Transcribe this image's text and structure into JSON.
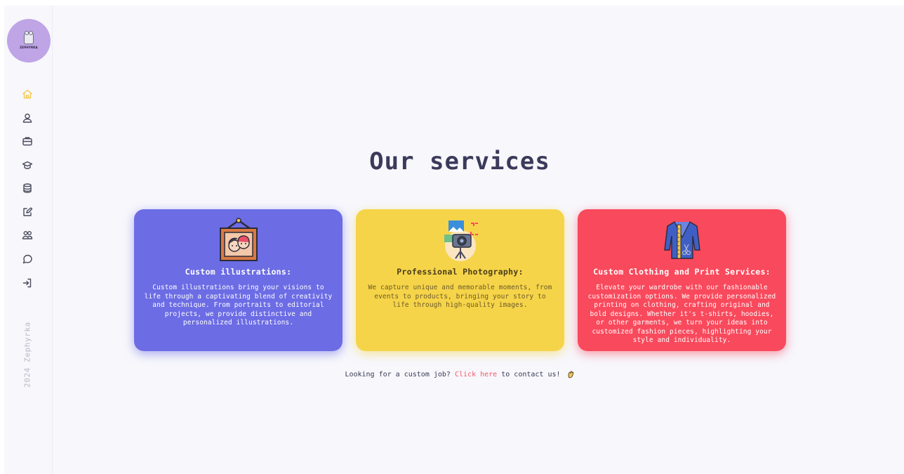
{
  "sidebar": {
    "brand": "ZEPHYRKA",
    "nav": [
      {
        "name": "home-icon",
        "active": true
      },
      {
        "name": "user-icon",
        "active": false
      },
      {
        "name": "briefcase-icon",
        "active": false
      },
      {
        "name": "graduation-cap-icon",
        "active": false
      },
      {
        "name": "database-icon",
        "active": false
      },
      {
        "name": "edit-icon",
        "active": false
      },
      {
        "name": "users-icon",
        "active": false
      },
      {
        "name": "chat-icon",
        "active": false
      },
      {
        "name": "sign-in-icon",
        "active": false
      }
    ],
    "copyright": "2024 Zephyrka",
    "active_color": "#f2c94c"
  },
  "main": {
    "title": "Our services",
    "cards": [
      {
        "title": "Custom illustrations:",
        "text": "Custom illustrations bring your visions to life through a captivating blend of creativity and technique. From portraits to editorial projects, we provide distinctive and personalized illustrations.",
        "color": "#6c6ce5",
        "icon": "framed-portrait-icon"
      },
      {
        "title": "Professional Photography:",
        "text": "We capture unique and memorable moments, from events to products, bringing your story to life through high-quality images.",
        "color": "#f6d449",
        "icon": "camera-icon"
      },
      {
        "title": "Custom Clothing and Print Services:",
        "text": "Elevate your wardrobe with our fashionable customization options. We provide personalized printing on clothing, crafting original and bold designs. Whether it's t-shirts, hoodies, or other garments, we turn your ideas into customized fashion pieces, highlighting your style and individuality.",
        "color": "#f9495c",
        "icon": "jacket-icon"
      }
    ],
    "contact": {
      "prefix": "Looking for a custom job?",
      "link": "Click here",
      "suffix": "to contact us!",
      "emoji_icon": "waving-hand-icon"
    }
  }
}
